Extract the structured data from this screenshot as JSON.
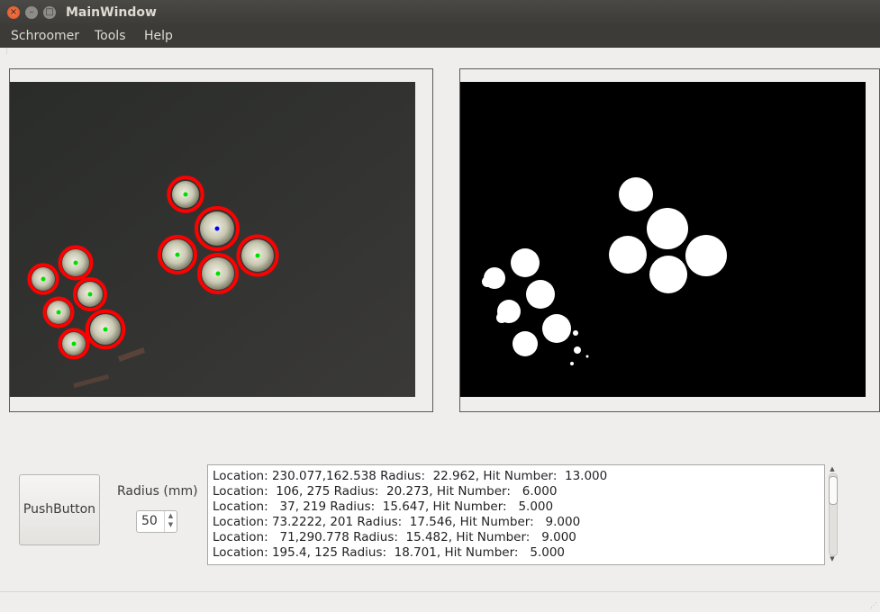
{
  "window": {
    "title": "MainWindow",
    "close_glyph": "×",
    "minimize_glyph": "–",
    "maximize_glyph": "□"
  },
  "menu": {
    "items": [
      "Schroomer",
      "Tools",
      "Help"
    ]
  },
  "views": {
    "left": "camera view with detected circles",
    "right": "binary mask"
  },
  "controls": {
    "push_button_label": "PushButton",
    "radius_label": "Radius (mm)",
    "radius_value": "50"
  },
  "log": {
    "lines": [
      "Location: 230.077,162.538 Radius:  22.962, Hit Number:  13.000",
      "Location:  106, 275 Radius:  20.273, Hit Number:   6.000",
      "Location:   37, 219 Radius:  15.647, Hit Number:   5.000",
      "Location: 73.2222, 201 Radius:  17.546, Hit Number:   9.000",
      "Location:   71,290.778 Radius:  15.482, Hit Number:   9.000",
      "Location: 195.4, 125 Radius:  18.701, Hit Number:   5.000"
    ]
  },
  "colors": {
    "titlebar": "#3c3b37",
    "close_button": "#e0531f",
    "circle_outline": "#ff0000",
    "center_dot": "#00e000",
    "highlight_dot": "#0000ff"
  }
}
